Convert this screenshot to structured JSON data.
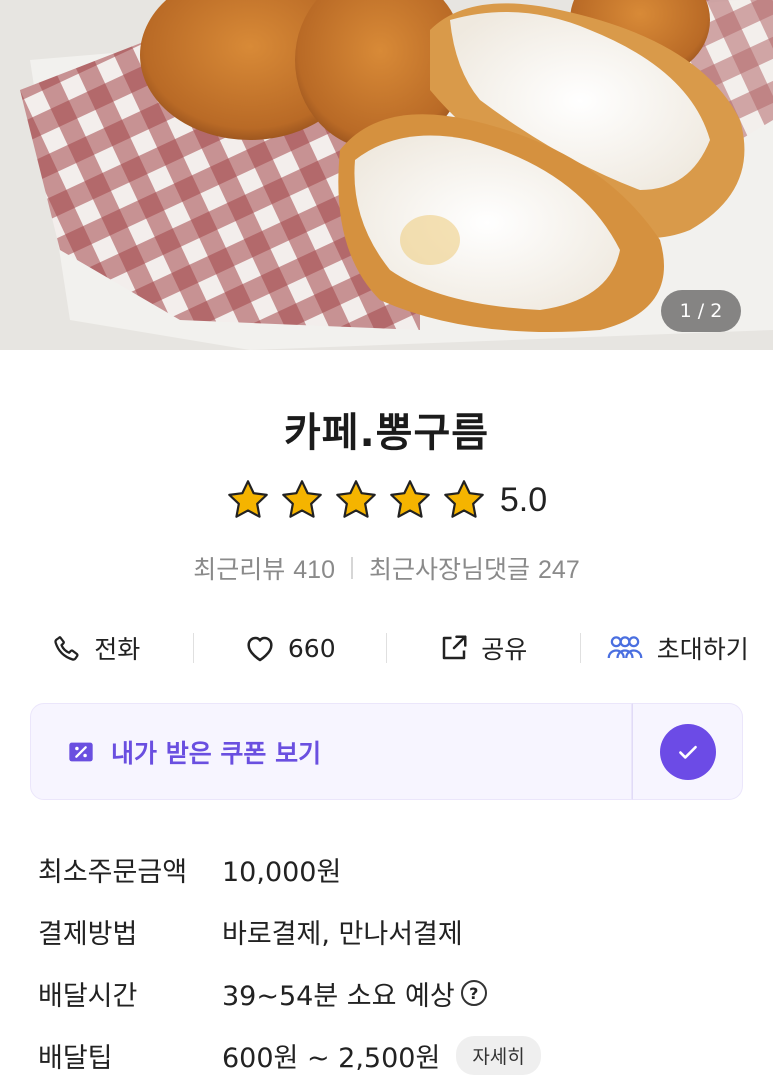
{
  "hero": {
    "counter": "1 / 2"
  },
  "store": {
    "name": "카페.뽕구름",
    "rating": "5.0",
    "stars": 5,
    "review_label": "최근리뷰",
    "review_count": "410",
    "owner_reply_label": "최근사장님댓글",
    "owner_reply_count": "247"
  },
  "actions": {
    "call": "전화",
    "like": "660",
    "share": "공유",
    "invite": "초대하기"
  },
  "coupon": {
    "label": "내가 받은 쿠폰 보기"
  },
  "info": {
    "min_order_key": "최소주문금액",
    "min_order_val": "10,000원",
    "payment_key": "결제방법",
    "payment_val": "바로결제, 만나서결제",
    "delivery_time_key": "배달시간",
    "delivery_time_val": "39~54분 소요 예상",
    "tip_key": "배달팁",
    "tip_val": "600원 ~ 2,500원",
    "detail_btn": "자세히"
  },
  "colors": {
    "accent": "#6c4be6",
    "star": "#f5b400",
    "invite_icon": "#4a6fe0"
  }
}
